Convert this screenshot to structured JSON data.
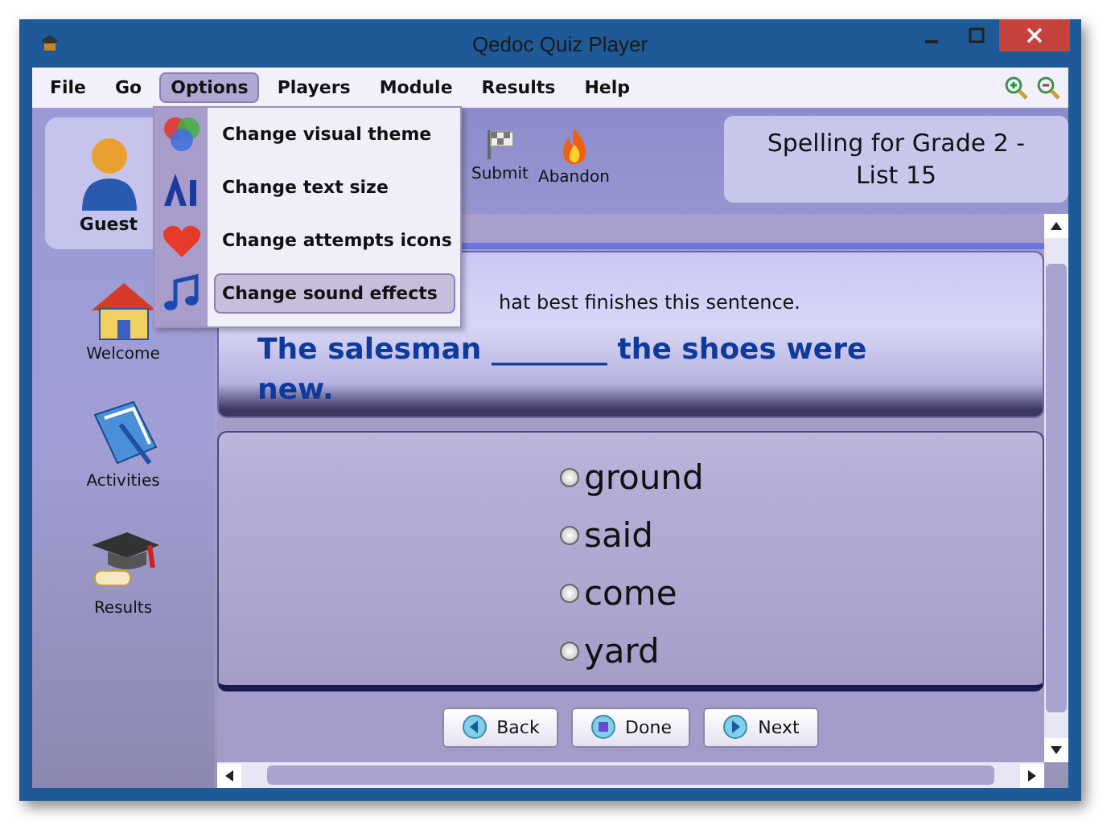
{
  "window": {
    "title": "Qedoc Quiz Player"
  },
  "menu_bar": [
    {
      "label": "File",
      "selected": false
    },
    {
      "label": "Go",
      "selected": false
    },
    {
      "label": "Options",
      "selected": true
    },
    {
      "label": "Players",
      "selected": false
    },
    {
      "label": "Module",
      "selected": false
    },
    {
      "label": "Results",
      "selected": false
    },
    {
      "label": "Help",
      "selected": false
    }
  ],
  "options_menu": [
    {
      "label": "Change visual theme",
      "kind": "theme",
      "selected": false
    },
    {
      "label": "Change text size",
      "kind": "text",
      "selected": false
    },
    {
      "label": "Change attempts icons",
      "kind": "heart",
      "selected": false
    },
    {
      "label": "Change sound effects",
      "kind": "music",
      "selected": true
    }
  ],
  "player": {
    "name": "Guest"
  },
  "sidebar": {
    "items": [
      {
        "label": "Welcome",
        "kind": "house"
      },
      {
        "label": "Activities",
        "kind": "book"
      },
      {
        "label": "Results",
        "kind": "cap"
      }
    ]
  },
  "toolbar": [
    {
      "label": "Submit",
      "kind": "flag"
    },
    {
      "label": "Abandon",
      "kind": "fire"
    }
  ],
  "module_title": "Spelling for Grade 2 - List 15",
  "question": {
    "instruction": "hat best finishes this sentence.",
    "sentence": "The salesman ________ the shoes were new.",
    "answers": [
      {
        "label": "ground",
        "selected": false
      },
      {
        "label": "said",
        "selected": false
      },
      {
        "label": "come",
        "selected": false
      },
      {
        "label": "yard",
        "selected": false
      }
    ]
  },
  "nav_buttons": [
    {
      "label": "Back",
      "kind": "back"
    },
    {
      "label": "Done",
      "kind": "done"
    },
    {
      "label": "Next",
      "kind": "next"
    }
  ]
}
